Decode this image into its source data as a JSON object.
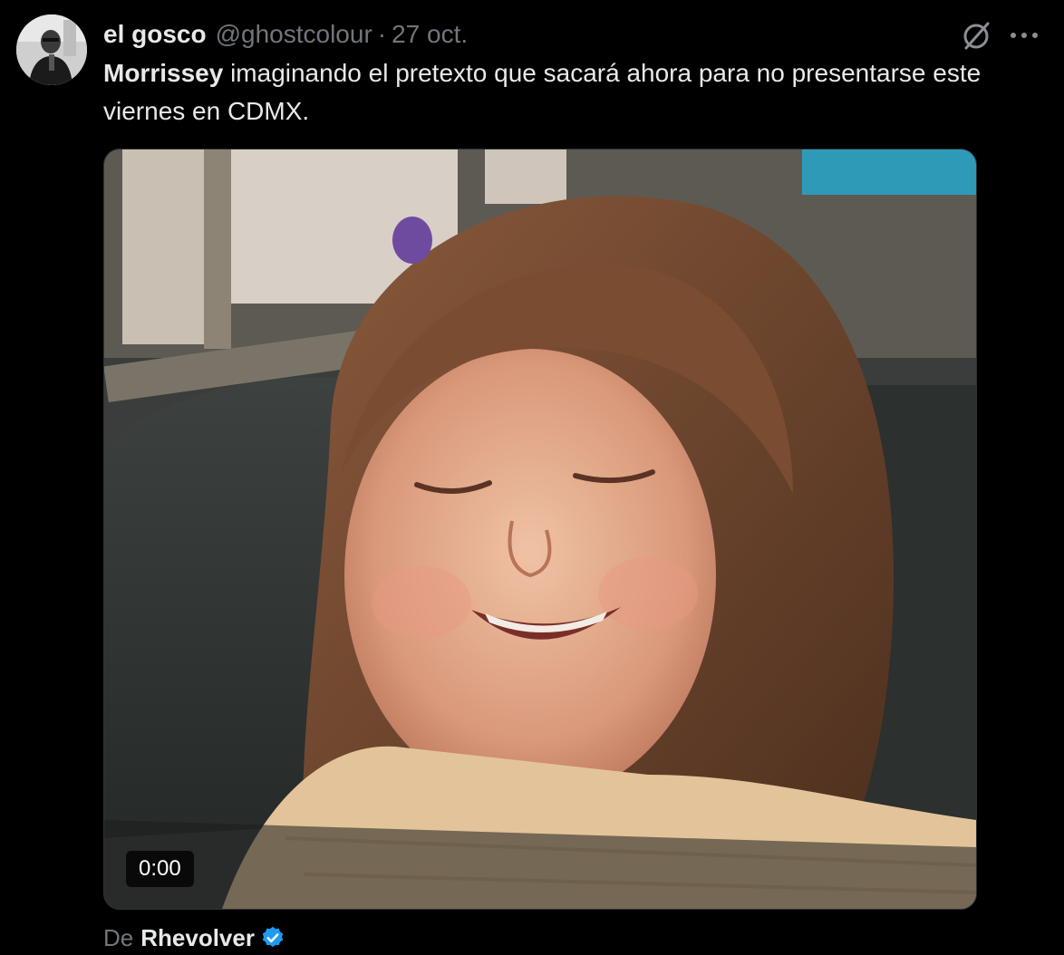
{
  "author": {
    "name": "el gosco",
    "handle": "@ghostcolour",
    "separator": "·",
    "time": "27 oct."
  },
  "tweet": {
    "mention": "Morrissey",
    "text_rest": " imaginando el pretexto que sacará ahora para no presentarse este viernes en CDMX."
  },
  "media": {
    "type": "video",
    "timer": "0:00"
  },
  "attribution": {
    "prefix": "De",
    "source": "Rhevolver",
    "verified": true
  },
  "icons": {
    "grok": "grok-slash-icon",
    "more": "more-dots-icon",
    "verified": "verified-badge-icon"
  },
  "colors": {
    "background": "#000000",
    "text": "#e7e9ea",
    "secondary": "#71767b",
    "verified": "#1d9bf0"
  }
}
